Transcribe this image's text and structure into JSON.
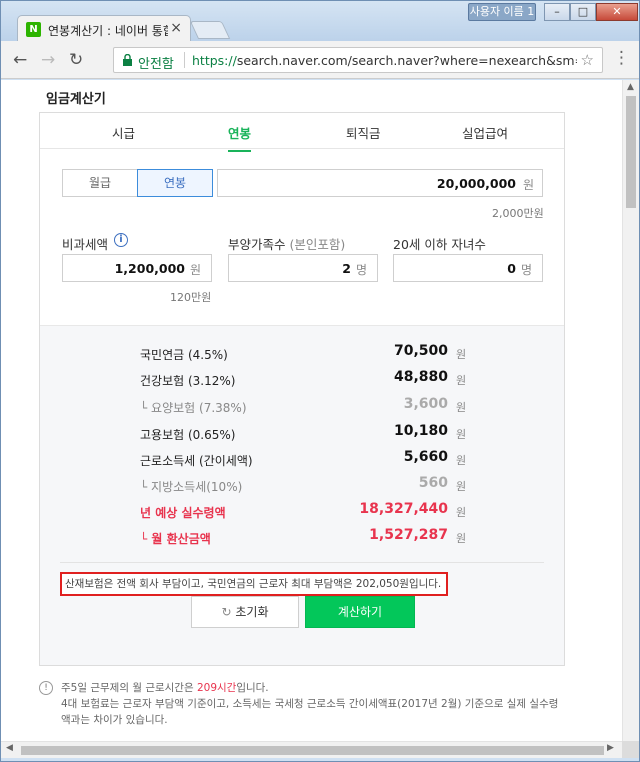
{
  "browser": {
    "tab_title": "연봉계산기 : 네이버 통합",
    "tab_close": "×",
    "favicon_letter": "N",
    "user_badge": "사용자 이름 1",
    "win_min": "–",
    "win_max": "□",
    "win_close": "✕",
    "back": "←",
    "forward": "→",
    "reload": "↻",
    "secure_label": "안전함",
    "url_scheme": "https://",
    "url_rest": "search.naver.com/search.naver?where=nexearch&sm=top_...",
    "star": "☆",
    "menu": "⋮"
  },
  "page": {
    "section_title": "임금계산기",
    "tabs": [
      {
        "label": "시급",
        "active": false
      },
      {
        "label": "연봉",
        "active": true
      },
      {
        "label": "퇴직금",
        "active": false
      },
      {
        "label": "실업급여",
        "active": false
      }
    ],
    "salary_type": {
      "options": [
        "월급",
        "연봉"
      ],
      "selected": "연봉"
    },
    "salary_input": {
      "value": "20,000,000",
      "unit": "원",
      "hint": "2,000만원"
    },
    "nontax": {
      "label": "비과세액",
      "info": "i",
      "value": "1,200,000",
      "unit": "원",
      "hint": "120만원"
    },
    "dependents": {
      "label": "부양가족수",
      "sub": "(본인포함)",
      "value": "2",
      "unit": "명"
    },
    "children": {
      "label": "20세 이하 자녀수",
      "value": "0",
      "unit": "명"
    },
    "results": [
      {
        "label": "국민연금 (4.5%)",
        "value": "70,500",
        "unit": "원",
        "style": "normal"
      },
      {
        "label": "건강보험 (3.12%)",
        "value": "48,880",
        "unit": "원",
        "style": "normal"
      },
      {
        "label": "└ 요양보험 (7.38%)",
        "value": "3,600",
        "unit": "원",
        "style": "sub"
      },
      {
        "label": "고용보험 (0.65%)",
        "value": "10,180",
        "unit": "원",
        "style": "normal"
      },
      {
        "label": "근로소득세 (간이세액)",
        "value": "5,660",
        "unit": "원",
        "style": "normal"
      },
      {
        "label": "└ 지방소득세(10%)",
        "value": "560",
        "unit": "원",
        "style": "sub"
      },
      {
        "label": "년 예상 실수령액",
        "value": "18,327,440",
        "unit": "원",
        "style": "red"
      },
      {
        "label": "└ 월 환산금액",
        "value": "1,527,287",
        "unit": "원",
        "style": "red"
      }
    ],
    "notice": "산재보험은 전액 회사 부담이고, 국민연금의 근로자 최대 부담액은 202,050원입니다.",
    "reset_icon": "↻",
    "reset_label": "초기화",
    "calc_label": "계산하기",
    "footnote_icon": "!",
    "footnote_line1_pre": "주5일 근무제의 월 근로시간은 ",
    "footnote_line1_hl": "209시간",
    "footnote_line1_post": "입니다.",
    "footnote_line2": "4대 보험료는 근로자 부담액 기준이고, 소득세는 국세청 근로소득 간이세액표(2017년 2월) 기준으로 실제 실수령",
    "footnote_line3": "액과는 차이가 있습니다."
  },
  "colors": {
    "accent_green": "#03c75a",
    "tab_active": "#19b35a",
    "highlight_red": "#e8344e",
    "notice_border": "#e02020",
    "segment_active": "#3c8cdb"
  }
}
